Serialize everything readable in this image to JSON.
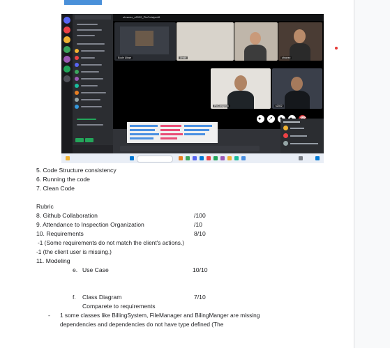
{
  "screenshot": {
    "call_title": "ohravez_s2022_PinCotsipe46",
    "participant_labels": [
      "Ecole Ulisse",
      "Unalb",
      "ohravez",
      "PinCotsipe46",
      "s2022"
    ]
  },
  "lines": {
    "l5": "5. Code Structure consistency",
    "l6": "6. Running the code",
    "l7": "7. Clean Code",
    "rubric": "Rubric",
    "l8": "8. Github Collaboration",
    "l9": "9. Attendance to Inspection Organization",
    "l10": "10. Requirements",
    "n1": "-1 (Some requirements do not match the client's actions.)",
    "n2": "-1 (the client user is missing.)",
    "l11": "11. Modeling",
    "e_letter": "e.",
    "e_label": "Use Case",
    "f_letter": "f.",
    "f_label": "Class Diagram",
    "compare": "Comparete to requirements",
    "bullet": "-",
    "bullet_text1": "1 some classes like BillingSystem, FileManager and BilingManger are missing",
    "bullet_text2": "dependencies and dependencies do not have type defined  (The"
  },
  "scores": {
    "s8": "/100",
    "s9": "/10",
    "s10": "8/10",
    "se": "10/10",
    "sf": "7/10"
  }
}
